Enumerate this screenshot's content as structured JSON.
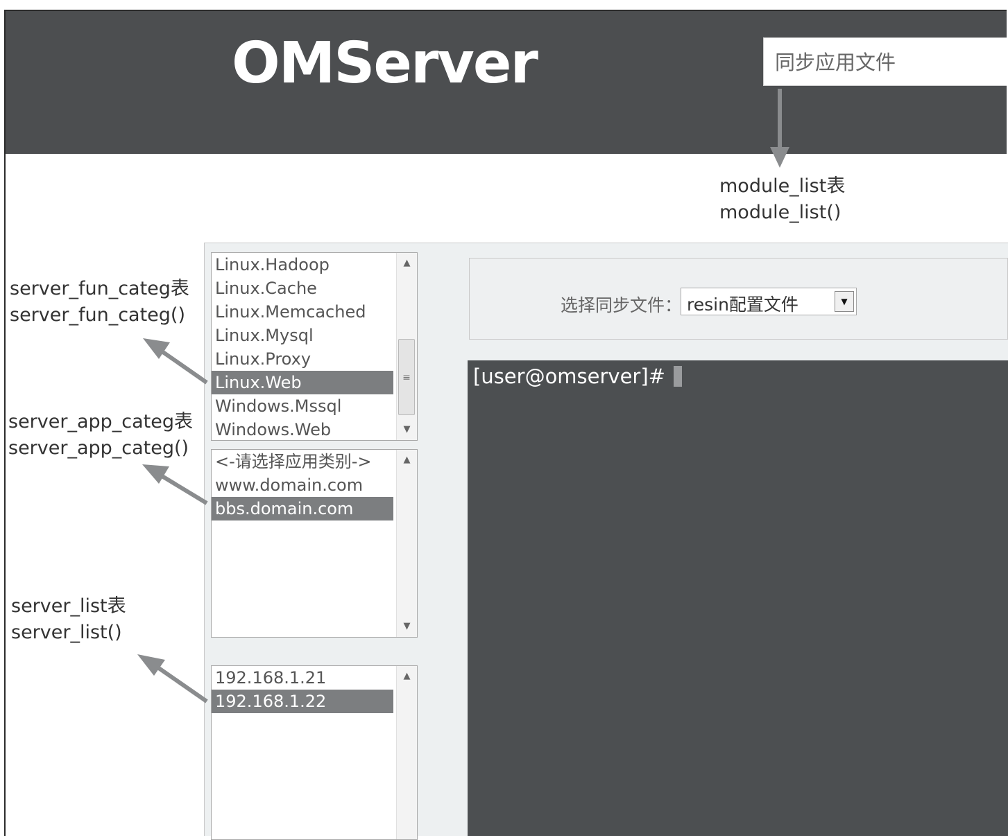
{
  "header": {
    "logo": "OMServer",
    "module_select_value": "同步应用文件"
  },
  "annotations": {
    "module_list": [
      "module_list表",
      "module_list()"
    ],
    "server_fun_categ": [
      "server_fun_categ表",
      "server_fun_categ()"
    ],
    "server_app_categ": [
      "server_app_categ表",
      "server_app_categ()"
    ],
    "server_list": [
      "server_list表",
      "server_list()"
    ]
  },
  "fun_categ_list": {
    "items": [
      "Linux.Hadoop",
      "Linux.Cache",
      "Linux.Memcached",
      "Linux.Mysql",
      "Linux.Proxy",
      "Linux.Web",
      "Windows.Mssql",
      "Windows.Web"
    ],
    "selected": "Linux.Web"
  },
  "app_categ_list": {
    "items": [
      "<-请选择应用类别->",
      "www.domain.com",
      "bbs.domain.com"
    ],
    "selected": "bbs.domain.com"
  },
  "server_list": {
    "items": [
      "192.168.1.21",
      "192.168.1.22"
    ],
    "selected": "192.168.1.22"
  },
  "sync": {
    "label": "选择同步文件：",
    "select_value": "resin配置文件"
  },
  "terminal": {
    "prompt": "[user@omserver]#"
  },
  "colors": {
    "header_bg": "#4c4e50",
    "terminal_bg": "#4c4f51",
    "selected_item_bg": "#7c7e80",
    "panel_bg": "#edf0f1"
  }
}
